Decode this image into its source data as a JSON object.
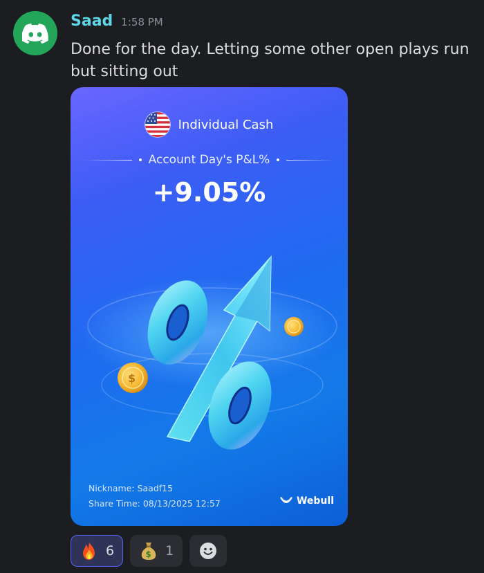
{
  "message": {
    "author": "Saad",
    "timestamp": "1:58 PM",
    "text": "Done for the day. Letting some other open plays run but sitting out",
    "avatar_icon": "discord-logo-icon",
    "author_color": "#5fd6e8"
  },
  "card": {
    "account_name": "Individual Cash",
    "pl_label": "Account Day's P&L%",
    "pl_value": "+9.05%",
    "nickname": "Nickname: Saadf15",
    "share_time": "Share Time: 08/13/2025 12:57",
    "brand": "Webull",
    "flag_icon": "us-flag-icon",
    "art_icon": "percent-arrow-coins-illustration"
  },
  "reactions": [
    {
      "emoji": "fire-emoji-icon",
      "count": "6",
      "reacted": true
    },
    {
      "emoji": "money-bag-emoji-icon",
      "count": "1",
      "reacted": false
    }
  ],
  "add_reaction_icon": "add-reaction-smiley-icon",
  "colors": {
    "background": "#1c1d21",
    "reaction_active_border": "#5865f2",
    "avatar": "#23a55a"
  }
}
